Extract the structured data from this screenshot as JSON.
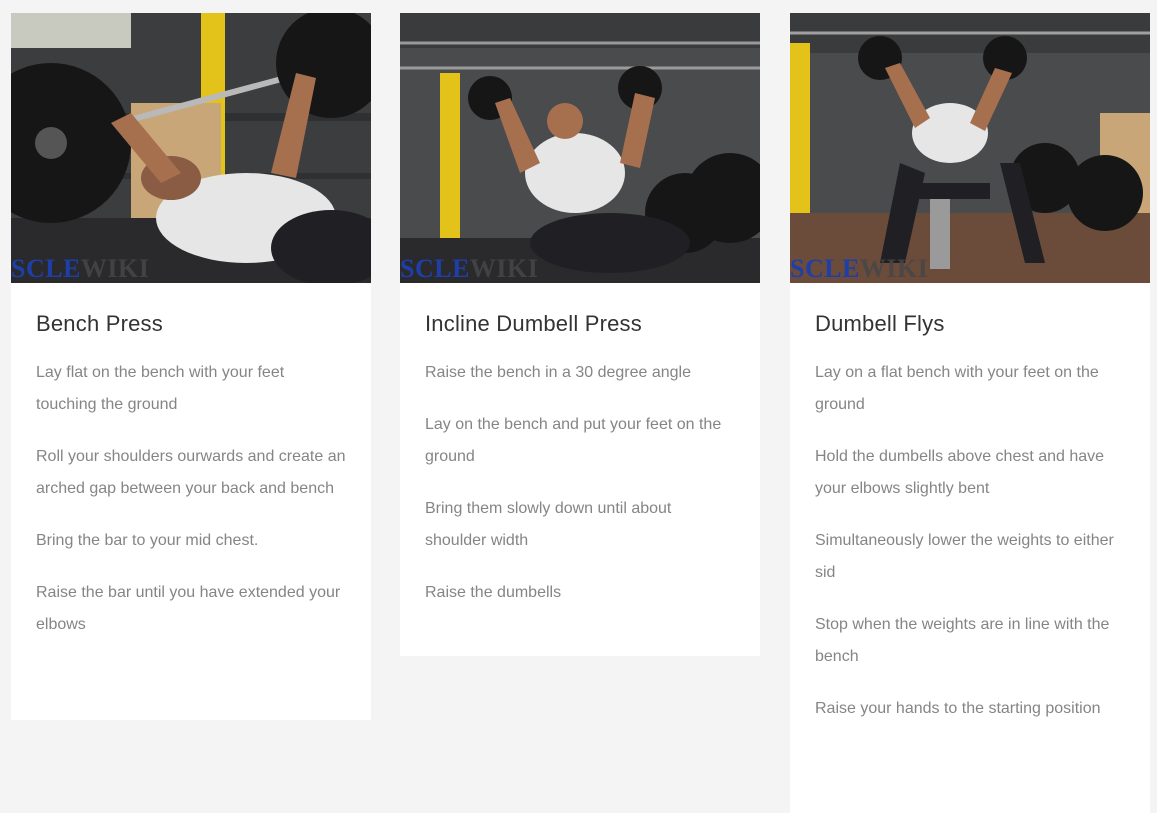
{
  "cards": [
    {
      "title": "Bench Press",
      "watermark": {
        "part1": "SCLE",
        "part2": "WIKI"
      },
      "steps": [
        "Lay flat on the bench with your feet touching the ground",
        "Roll your shoulders ourwards and create an arched gap between your back and bench",
        "Bring the bar to your mid chest.",
        "Raise the bar until you have extended your elbows"
      ]
    },
    {
      "title": "Incline Dumbell Press",
      "watermark": {
        "part1": "SCLE",
        "part2": "WIKI"
      },
      "steps": [
        "Raise the bench in a 30 degree angle",
        "Lay on the bench and put your feet on the ground",
        "Bring them slowly down until about shoulder width",
        "Raise the dumbells"
      ]
    },
    {
      "title": "Dumbell Flys",
      "watermark": {
        "part1": "SCLE",
        "part2": "WIKI"
      },
      "steps": [
        "Lay on a flat bench with your feet on the ground",
        "Hold the dumbells above chest and have your elbows slightly bent",
        "Simultaneously lower the weights to either sid",
        "Stop when the weights are in line with the bench",
        "Raise your hands to the starting position"
      ]
    }
  ],
  "colors": {
    "page_bg": "#f4f4f4",
    "card_bg": "#ffffff",
    "title_text": "#333333",
    "step_text": "#858585",
    "watermark_blue": "#1f3fa8"
  }
}
